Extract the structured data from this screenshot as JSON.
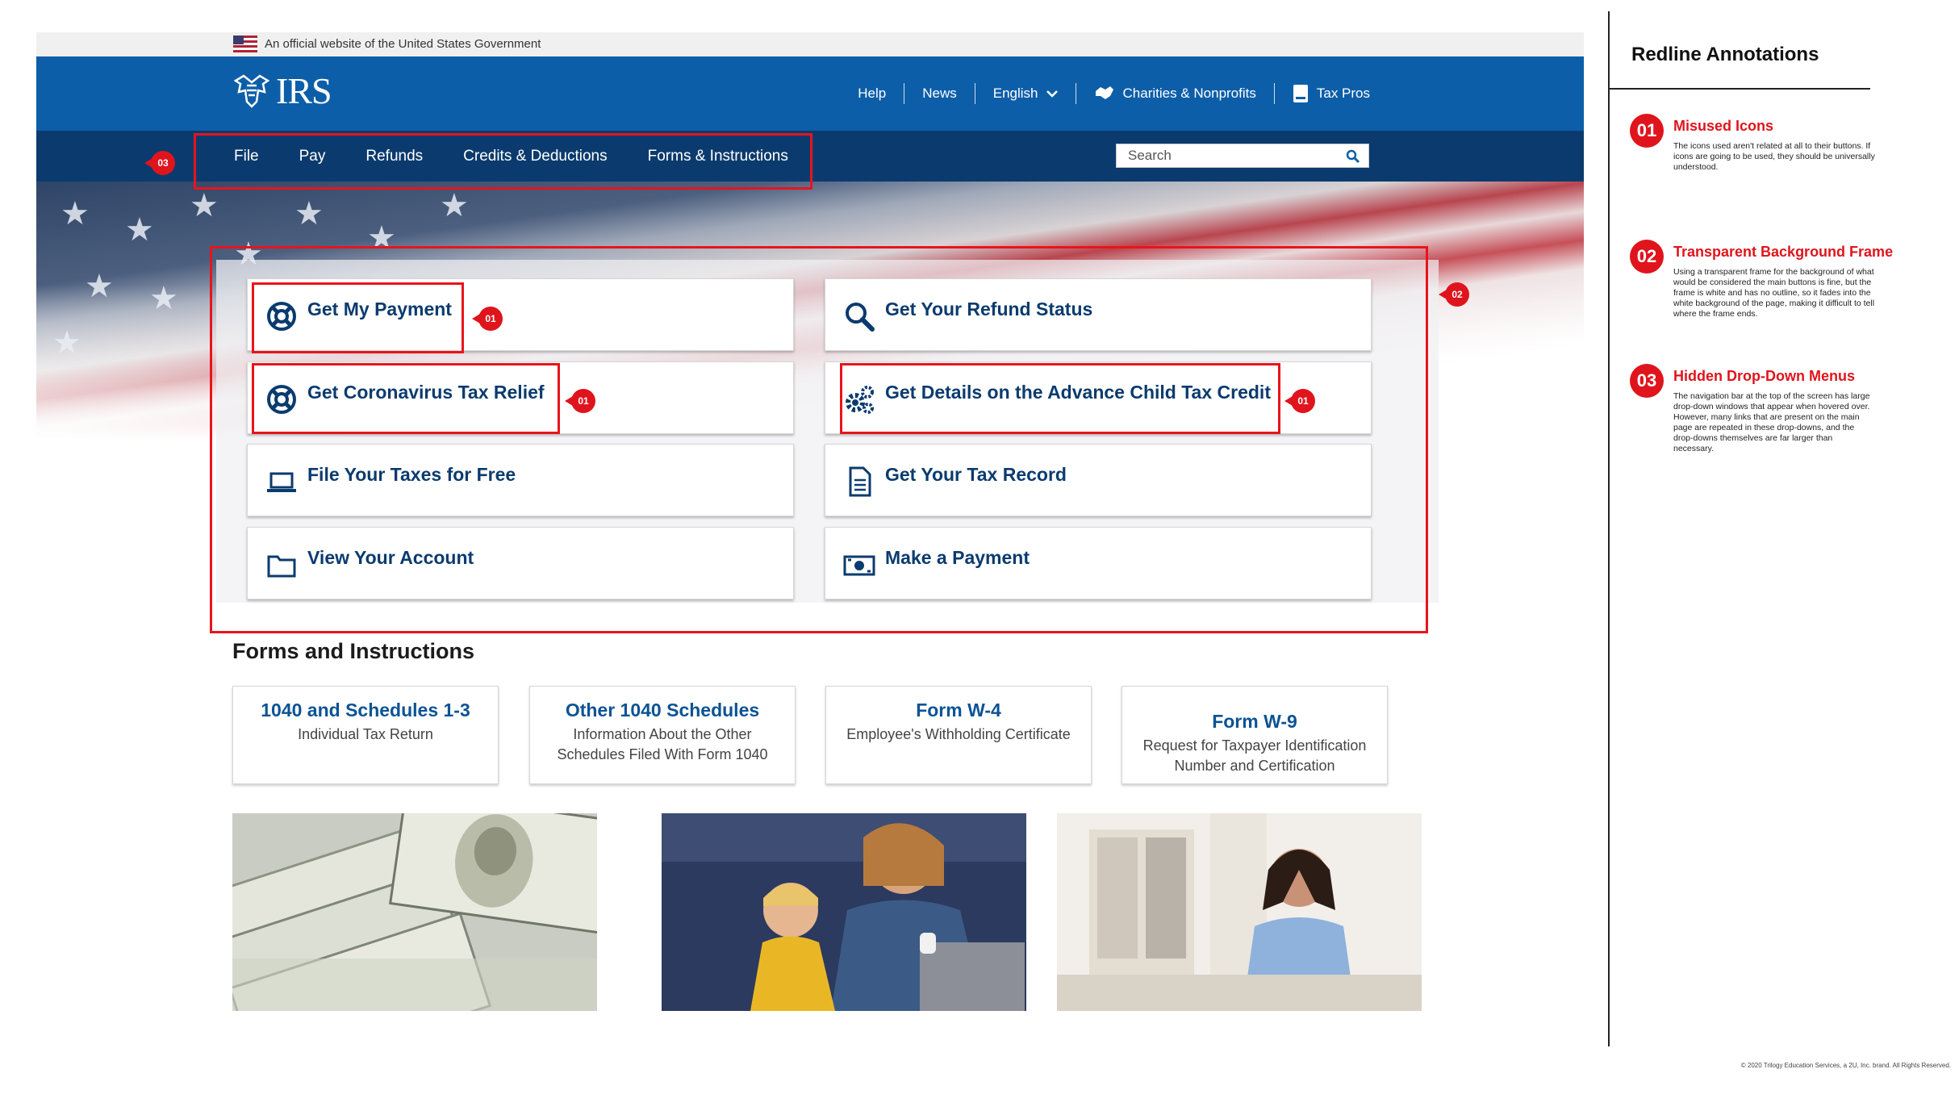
{
  "gov_banner": {
    "text": "An official website of the United States Government"
  },
  "header": {
    "logo_text": "IRS",
    "util_nav": [
      {
        "label": "Help"
      },
      {
        "label": "News"
      },
      {
        "label": "English"
      },
      {
        "label": "Charities & Nonprofits"
      },
      {
        "label": "Tax Pros"
      }
    ]
  },
  "main_nav": {
    "items": [
      "File",
      "Pay",
      "Refunds",
      "Credits & Deductions",
      "Forms & Instructions"
    ],
    "search_placeholder": "Search"
  },
  "actions": [
    {
      "label": "Get My Payment",
      "icon": "life-ring-icon"
    },
    {
      "label": "Get Your Refund Status",
      "icon": "search-icon"
    },
    {
      "label": "Get Coronavirus Tax Relief",
      "icon": "life-ring-icon"
    },
    {
      "label": "Get Details on the Advance Child Tax Credit",
      "icon": "gears-icon"
    },
    {
      "label": "File Your Taxes for Free",
      "icon": "laptop-icon"
    },
    {
      "label": "Get Your Tax Record",
      "icon": "document-icon"
    },
    {
      "label": "View Your Account",
      "icon": "folder-icon"
    },
    {
      "label": "Make a Payment",
      "icon": "money-icon"
    }
  ],
  "forms": {
    "title": "Forms and Instructions",
    "cards": [
      {
        "title": "1040 and Schedules 1-3",
        "subtitle": "Individual Tax Return"
      },
      {
        "title": "Other 1040 Schedules",
        "subtitle": "Information About the Other Schedules Filed With Form 1040"
      },
      {
        "title": "Form W-4",
        "subtitle": "Employee's Withholding Certificate"
      },
      {
        "title": "Form W-9",
        "subtitle": "Request for Taxpayer Identification Number and Certification"
      }
    ]
  },
  "badges": {
    "b01": "01",
    "b02": "02",
    "b03": "03"
  },
  "panel": {
    "title": "Redline Annotations",
    "notes": [
      {
        "num": "01",
        "title": "Misused Icons",
        "text": "The icons used aren't related at all to their buttons. If icons are going to be used, they should be universally understood."
      },
      {
        "num": "02",
        "title": "Transparent Background Frame",
        "text": "Using a transparent frame for the background of what would be considered the main buttons is fine, but the frame is white and has no outline, so it fades into the white background of the page, making it difficult to tell where the frame ends."
      },
      {
        "num": "03",
        "title": "Hidden Drop-Down Menus",
        "text": "The navigation bar at the top of the screen has large drop-down windows that appear when hovered over. However, many links that are present on the main page are repeated in these drop-downs, and the drop-downs themselves are far larger than necessary."
      }
    ],
    "copyright": "© 2020 Trilogy Education Services, a 2U, Inc. brand. All Rights Reserved."
  },
  "colors": {
    "header_blue": "#0d5ea8",
    "nav_navy": "#0b3b6e",
    "redline": "#e0141c",
    "link_blue": "#0b3b6e"
  }
}
